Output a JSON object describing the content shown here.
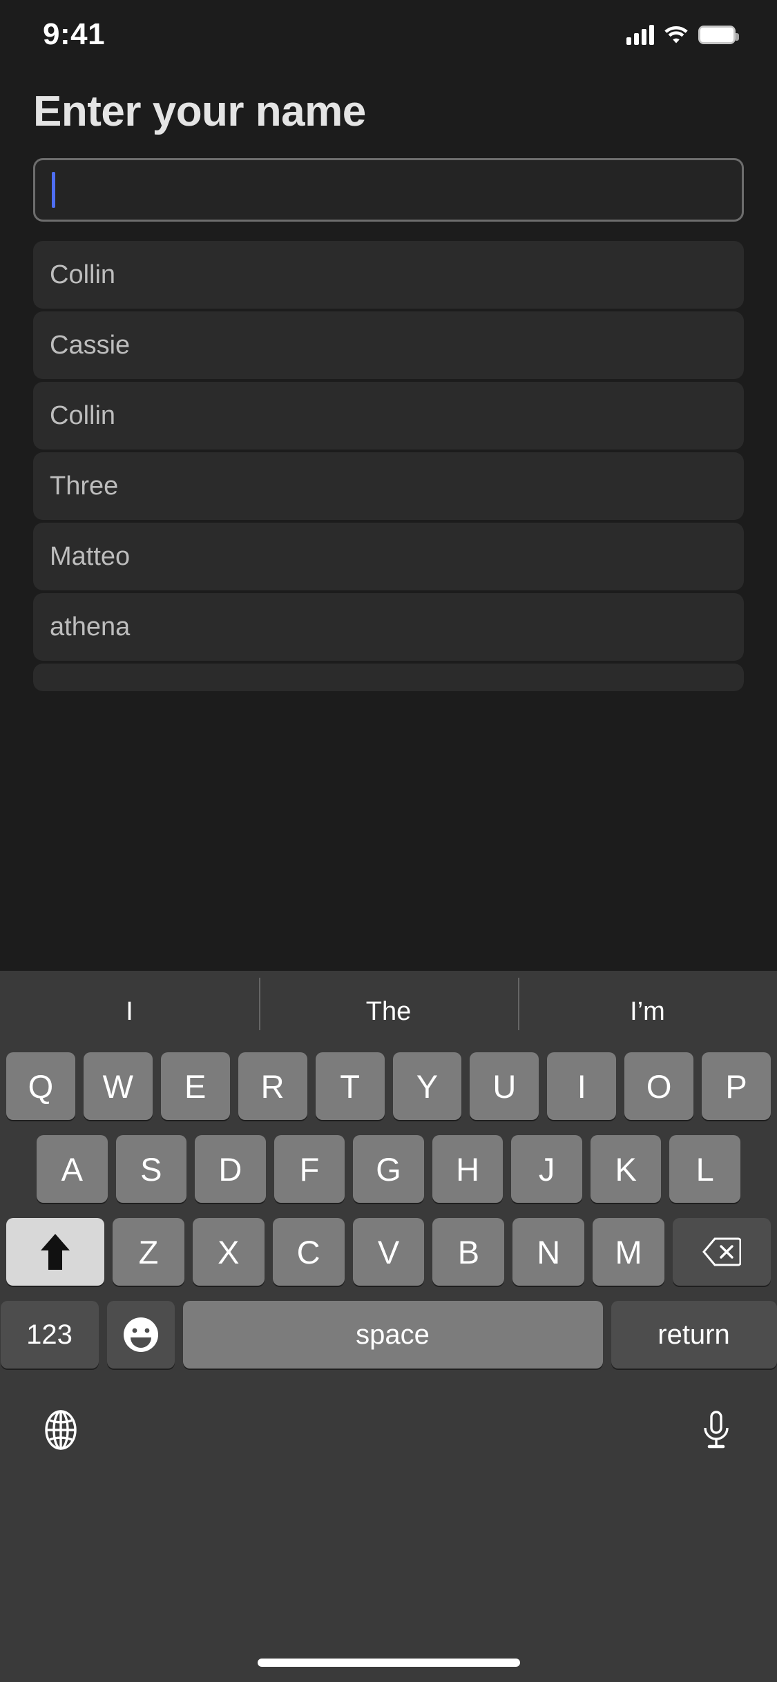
{
  "status_bar": {
    "time": "9:41",
    "signal_icon": "cellular-signal-icon",
    "wifi_icon": "wifi-icon",
    "battery_icon": "battery-icon"
  },
  "screen": {
    "title": "Enter your name",
    "text_field": {
      "value": "",
      "placeholder": "",
      "caret_color": "#4e6ef2",
      "border_color": "#6d6d6d"
    },
    "name_list": [
      {
        "label": "Collin"
      },
      {
        "label": "Cassie"
      },
      {
        "label": "Collin"
      },
      {
        "label": "Three"
      },
      {
        "label": "Matteo"
      },
      {
        "label": "athena"
      },
      {
        "label": ""
      }
    ]
  },
  "keyboard": {
    "suggestions": [
      "I",
      "The",
      "I’m"
    ],
    "row1": [
      "Q",
      "W",
      "E",
      "R",
      "T",
      "Y",
      "U",
      "I",
      "O",
      "P"
    ],
    "row2": [
      "A",
      "S",
      "D",
      "F",
      "G",
      "H",
      "J",
      "K",
      "L"
    ],
    "row3": [
      "Z",
      "X",
      "C",
      "V",
      "B",
      "N",
      "M"
    ],
    "shift_key": {
      "name": "shift-key",
      "icon": "shift-arrow-icon",
      "active": true
    },
    "backspace_key": {
      "name": "backspace-key",
      "icon": "backspace-icon"
    },
    "numbers_key": {
      "label": "123"
    },
    "emoji_key": {
      "icon": "emoji-smiley-icon"
    },
    "space_key": {
      "label": "space"
    },
    "return_key": {
      "label": "return"
    },
    "globe_key": {
      "icon": "globe-icon"
    },
    "dictation_key": {
      "icon": "microphone-icon"
    },
    "colors": {
      "background": "#3a3a3a",
      "key": "#7c7c7c",
      "key_dark": "#4d4d4d",
      "key_light": "#d8d8d8"
    }
  },
  "home_indicator": {
    "name": "home-indicator"
  }
}
